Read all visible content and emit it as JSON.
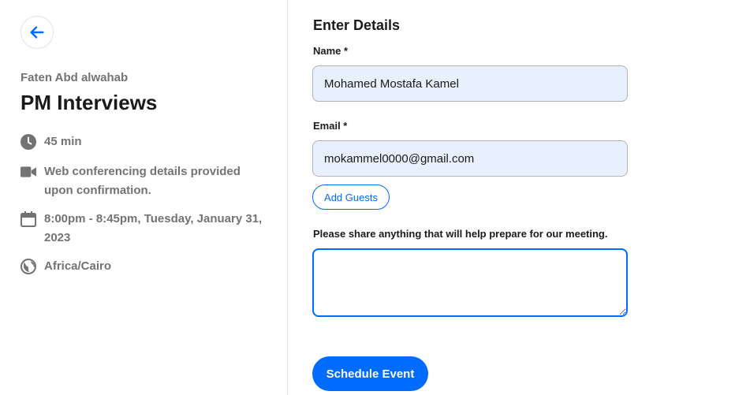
{
  "event": {
    "organizer": "Faten Abd alwahab",
    "title": "PM Interviews",
    "duration": "45 min",
    "location": "Web conferencing details provided upon confirmation.",
    "datetime": "8:00pm - 8:45pm, Tuesday, January 31, 2023",
    "timezone": "Africa/Cairo"
  },
  "icons": {
    "back": "arrow-left-icon",
    "duration": "clock-icon",
    "location": "video-camera-icon",
    "datetime": "calendar-icon",
    "timezone": "globe-icon"
  },
  "form": {
    "heading": "Enter Details",
    "name_label": "Name *",
    "name_value": "Mohamed Mostafa Kamel",
    "email_label": "Email *",
    "email_value": "mokammel0000@gmail.com",
    "add_guests_label": "Add Guests",
    "notes_label": "Please share anything that will help prepare for our meeting.",
    "notes_value": "",
    "submit_label": "Schedule Event"
  },
  "colors": {
    "accent": "#006bff",
    "input_bg": "#e8f0fe",
    "muted_text": "#737373",
    "icon": "#737373"
  }
}
